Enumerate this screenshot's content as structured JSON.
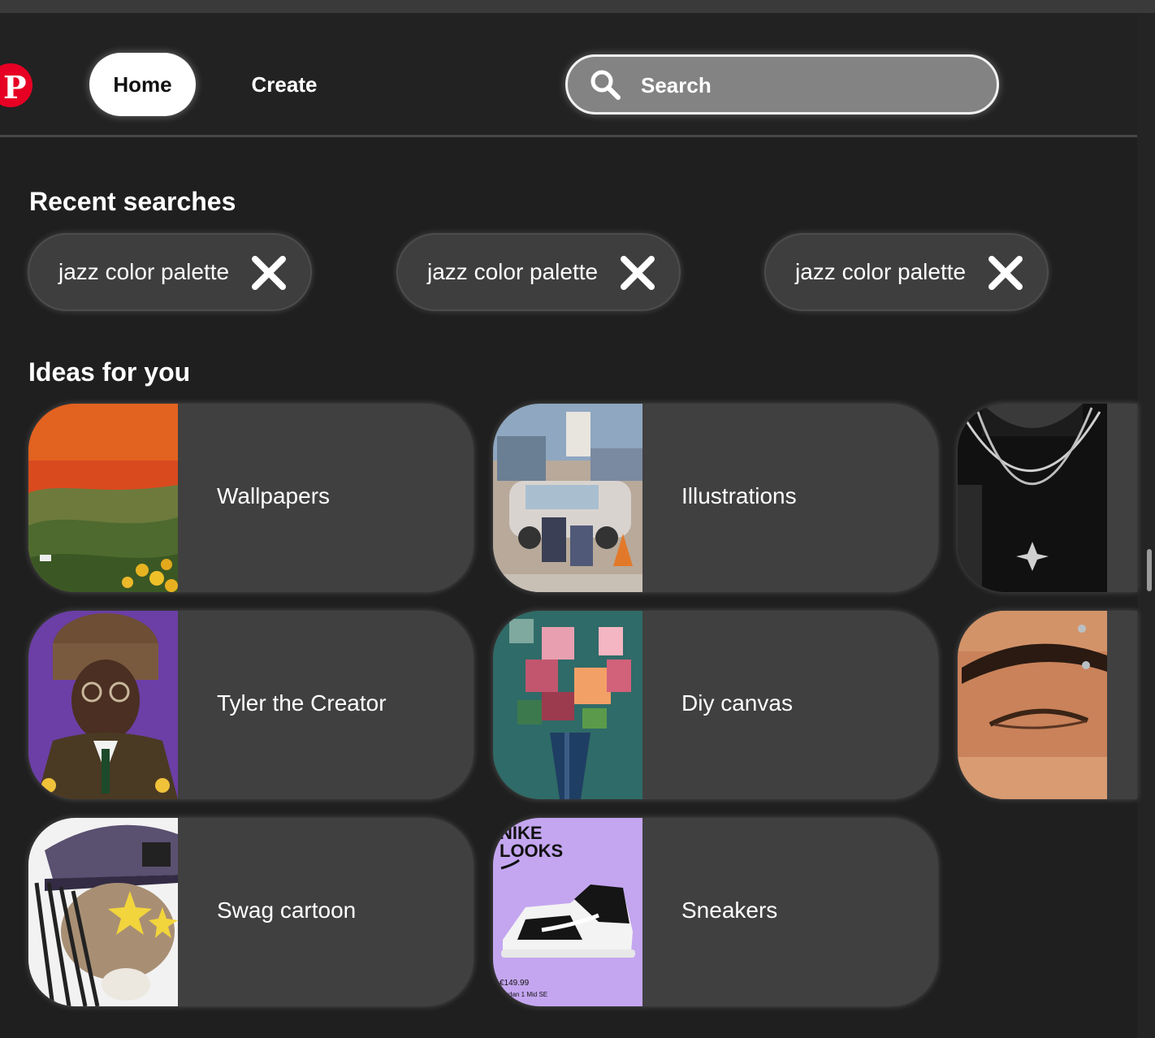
{
  "header": {
    "logo_icon": "pinterest-logo",
    "brand_color": "#e60023",
    "nav": [
      {
        "label": "Home",
        "active": true
      },
      {
        "label": "Create",
        "active": false
      }
    ],
    "search": {
      "placeholder": "Search",
      "value": "",
      "icon": "search-icon"
    }
  },
  "recent_searches": {
    "title": "Recent searches",
    "items": [
      {
        "label": "jazz color palette",
        "remove_icon": "close-icon"
      },
      {
        "label": "jazz color palette",
        "remove_icon": "close-icon"
      },
      {
        "label": "jazz color palette",
        "remove_icon": "close-icon"
      }
    ]
  },
  "ideas": {
    "title": "Ideas for you",
    "items": [
      {
        "label": "Wallpapers"
      },
      {
        "label": "Illustrations"
      },
      {
        "label": ""
      },
      {
        "label": "Tyler the Creator"
      },
      {
        "label": "Diy canvas"
      },
      {
        "label": ""
      },
      {
        "label": "Swag cartoon"
      },
      {
        "label": "Sneakers"
      }
    ],
    "sneaker_thumb": {
      "brand": "NIKE",
      "tagline": "LOOKS",
      "price": "€149.99",
      "product": "Jordan 1 Mid SE"
    }
  }
}
